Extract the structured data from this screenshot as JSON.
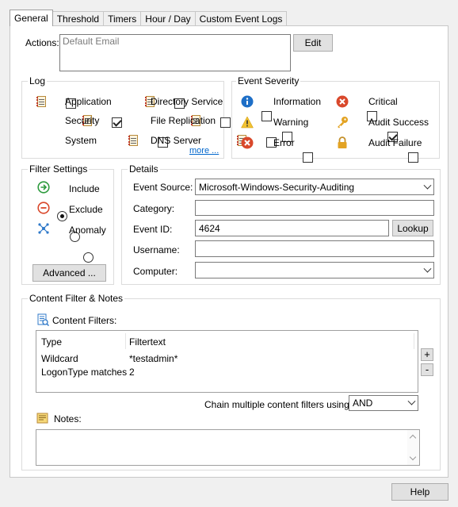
{
  "tabs": [
    {
      "label": "General"
    },
    {
      "label": "Threshold"
    },
    {
      "label": "Timers"
    },
    {
      "label": "Hour / Day"
    },
    {
      "label": "Custom Event Logs"
    }
  ],
  "actions": {
    "label": "Actions:",
    "value": "Default Email",
    "edit_label": "Edit"
  },
  "log": {
    "title": "Log",
    "items": [
      {
        "label": "Application",
        "checked": false
      },
      {
        "label": "Directory Service",
        "checked": false
      },
      {
        "label": "Security",
        "checked": true
      },
      {
        "label": "File Replication",
        "checked": false
      },
      {
        "label": "System",
        "checked": false
      },
      {
        "label": "DNS Server",
        "checked": false
      }
    ],
    "more": "more ..."
  },
  "severity": {
    "title": "Event Severity",
    "items": [
      {
        "label": "Information",
        "icon": "info-icon",
        "checked": false
      },
      {
        "label": "Critical",
        "icon": "critical-icon",
        "checked": false
      },
      {
        "label": "Warning",
        "icon": "warning-icon",
        "checked": false
      },
      {
        "label": "Audit Success",
        "icon": "key-icon",
        "checked": true
      },
      {
        "label": "Error",
        "icon": "error-icon",
        "checked": false
      },
      {
        "label": "Audit Failure",
        "icon": "lock-icon",
        "checked": false
      }
    ]
  },
  "filter": {
    "title": "Filter Settings",
    "options": [
      {
        "label": "Include",
        "icon": "include-icon",
        "selected": true
      },
      {
        "label": "Exclude",
        "icon": "exclude-icon",
        "selected": false
      },
      {
        "label": "Anomaly",
        "icon": "anomaly-icon",
        "selected": false
      }
    ],
    "advanced": "Advanced ..."
  },
  "details": {
    "title": "Details",
    "event_source_label": "Event Source:",
    "event_source_value": "Microsoft-Windows-Security-Auditing",
    "category_label": "Category:",
    "category_value": "",
    "event_id_label": "Event ID:",
    "event_id_value": "4624",
    "lookup": "Lookup",
    "username_label": "Username:",
    "username_value": "",
    "computer_label": "Computer:",
    "computer_value": ""
  },
  "content": {
    "title": "Content Filter & Notes",
    "filters_label": "Content Filters:",
    "columns": [
      "Type",
      "Filtertext"
    ],
    "rows": [
      [
        "Wildcard",
        "*testadmin*"
      ],
      [
        "LogonType matches",
        "2"
      ]
    ],
    "add": "+",
    "remove": "-",
    "chain_label": "Chain multiple content filters using a",
    "chain_value": "AND",
    "notes_label": "Notes:",
    "notes_value": ""
  },
  "help": "Help"
}
